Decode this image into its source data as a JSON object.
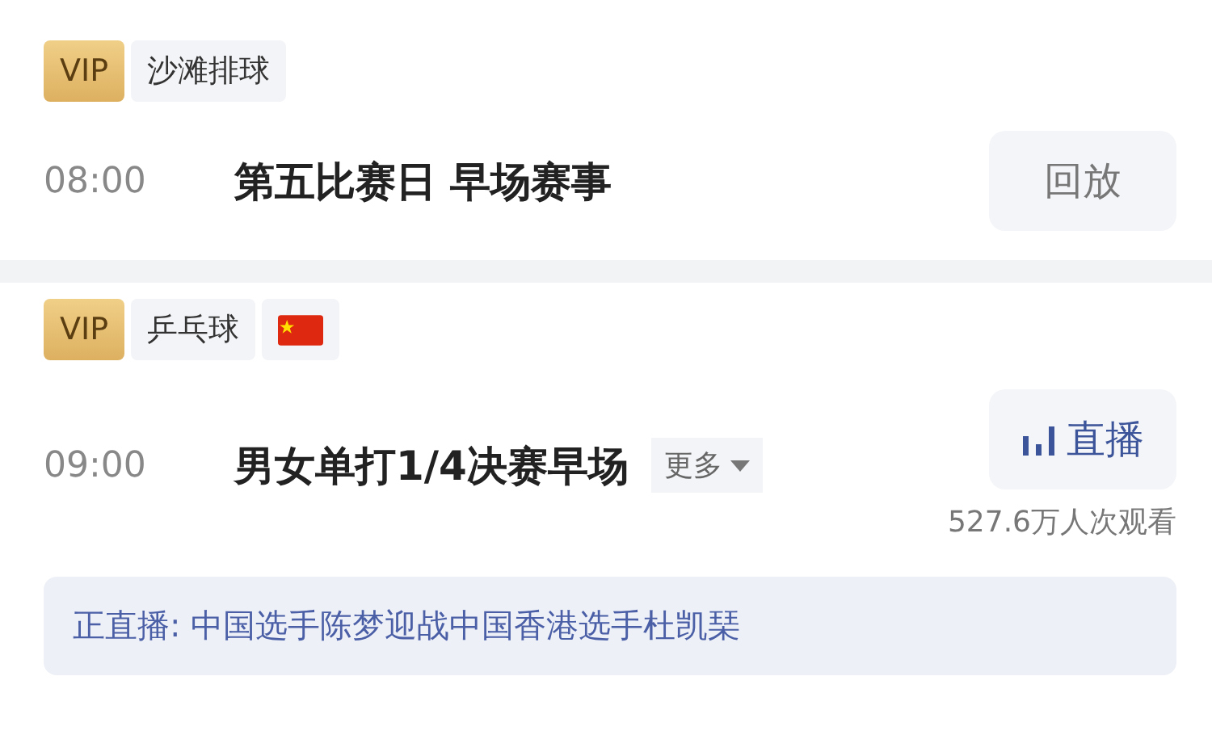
{
  "matches": [
    {
      "tags": [
        {
          "kind": "vip",
          "label": "VIP"
        },
        {
          "kind": "sport",
          "label": "沙滩排球"
        }
      ],
      "time": "08:00",
      "title": "第五比赛日 早场赛事",
      "action": {
        "kind": "replay",
        "label": "回放"
      }
    },
    {
      "tags": [
        {
          "kind": "vip",
          "label": "VIP"
        },
        {
          "kind": "sport",
          "label": "乒乓球"
        },
        {
          "kind": "flag"
        }
      ],
      "time": "09:00",
      "title": "男女单打1/4决赛早场",
      "more": "更多",
      "action": {
        "kind": "live",
        "label": "直播"
      },
      "views": "527.6万人次观看",
      "now_playing": "正直播: 中国选手陈梦迎战中国香港选手杜凯琹"
    }
  ]
}
